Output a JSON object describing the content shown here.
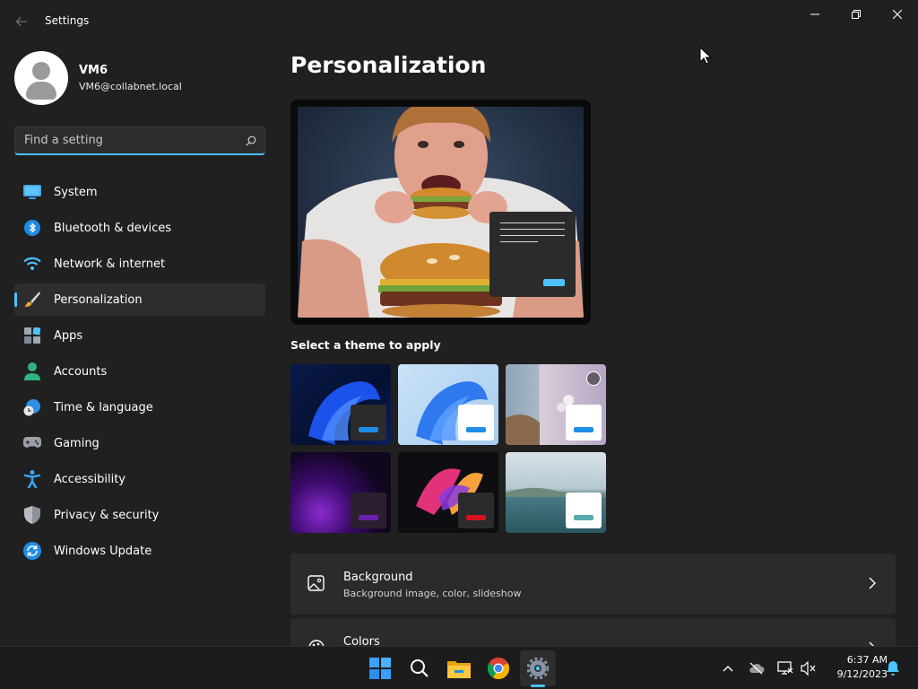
{
  "window": {
    "title": "Settings"
  },
  "user": {
    "name": "VM6",
    "email": "VM6@collabnet.local"
  },
  "search": {
    "placeholder": "Find a setting"
  },
  "nav": {
    "items": [
      {
        "label": "System",
        "icon": "system-icon"
      },
      {
        "label": "Bluetooth & devices",
        "icon": "bluetooth-icon"
      },
      {
        "label": "Network & internet",
        "icon": "wifi-icon"
      },
      {
        "label": "Personalization",
        "icon": "brush-icon",
        "active": true
      },
      {
        "label": "Apps",
        "icon": "apps-icon"
      },
      {
        "label": "Accounts",
        "icon": "account-icon"
      },
      {
        "label": "Time & language",
        "icon": "clock-globe-icon"
      },
      {
        "label": "Gaming",
        "icon": "gamepad-icon"
      },
      {
        "label": "Accessibility",
        "icon": "accessibility-icon"
      },
      {
        "label": "Privacy & security",
        "icon": "shield-icon"
      },
      {
        "label": "Windows Update",
        "icon": "update-icon"
      }
    ]
  },
  "main": {
    "title": "Personalization",
    "themes_heading": "Select a theme to apply",
    "cards": [
      {
        "title": "Background",
        "description": "Background image, color, slideshow",
        "icon": "image-icon"
      },
      {
        "title": "Colors",
        "description": "",
        "icon": "palette-icon"
      }
    ]
  },
  "taskbar": {
    "time": "6:37 AM",
    "date": "9/12/2023",
    "apps": [
      "start-icon",
      "search-icon",
      "file-explorer-icon",
      "chrome-icon",
      "settings-icon"
    ]
  },
  "colors": {
    "accent": "#4cc2ff",
    "background": "#202020",
    "card": "#2b2b2b"
  }
}
